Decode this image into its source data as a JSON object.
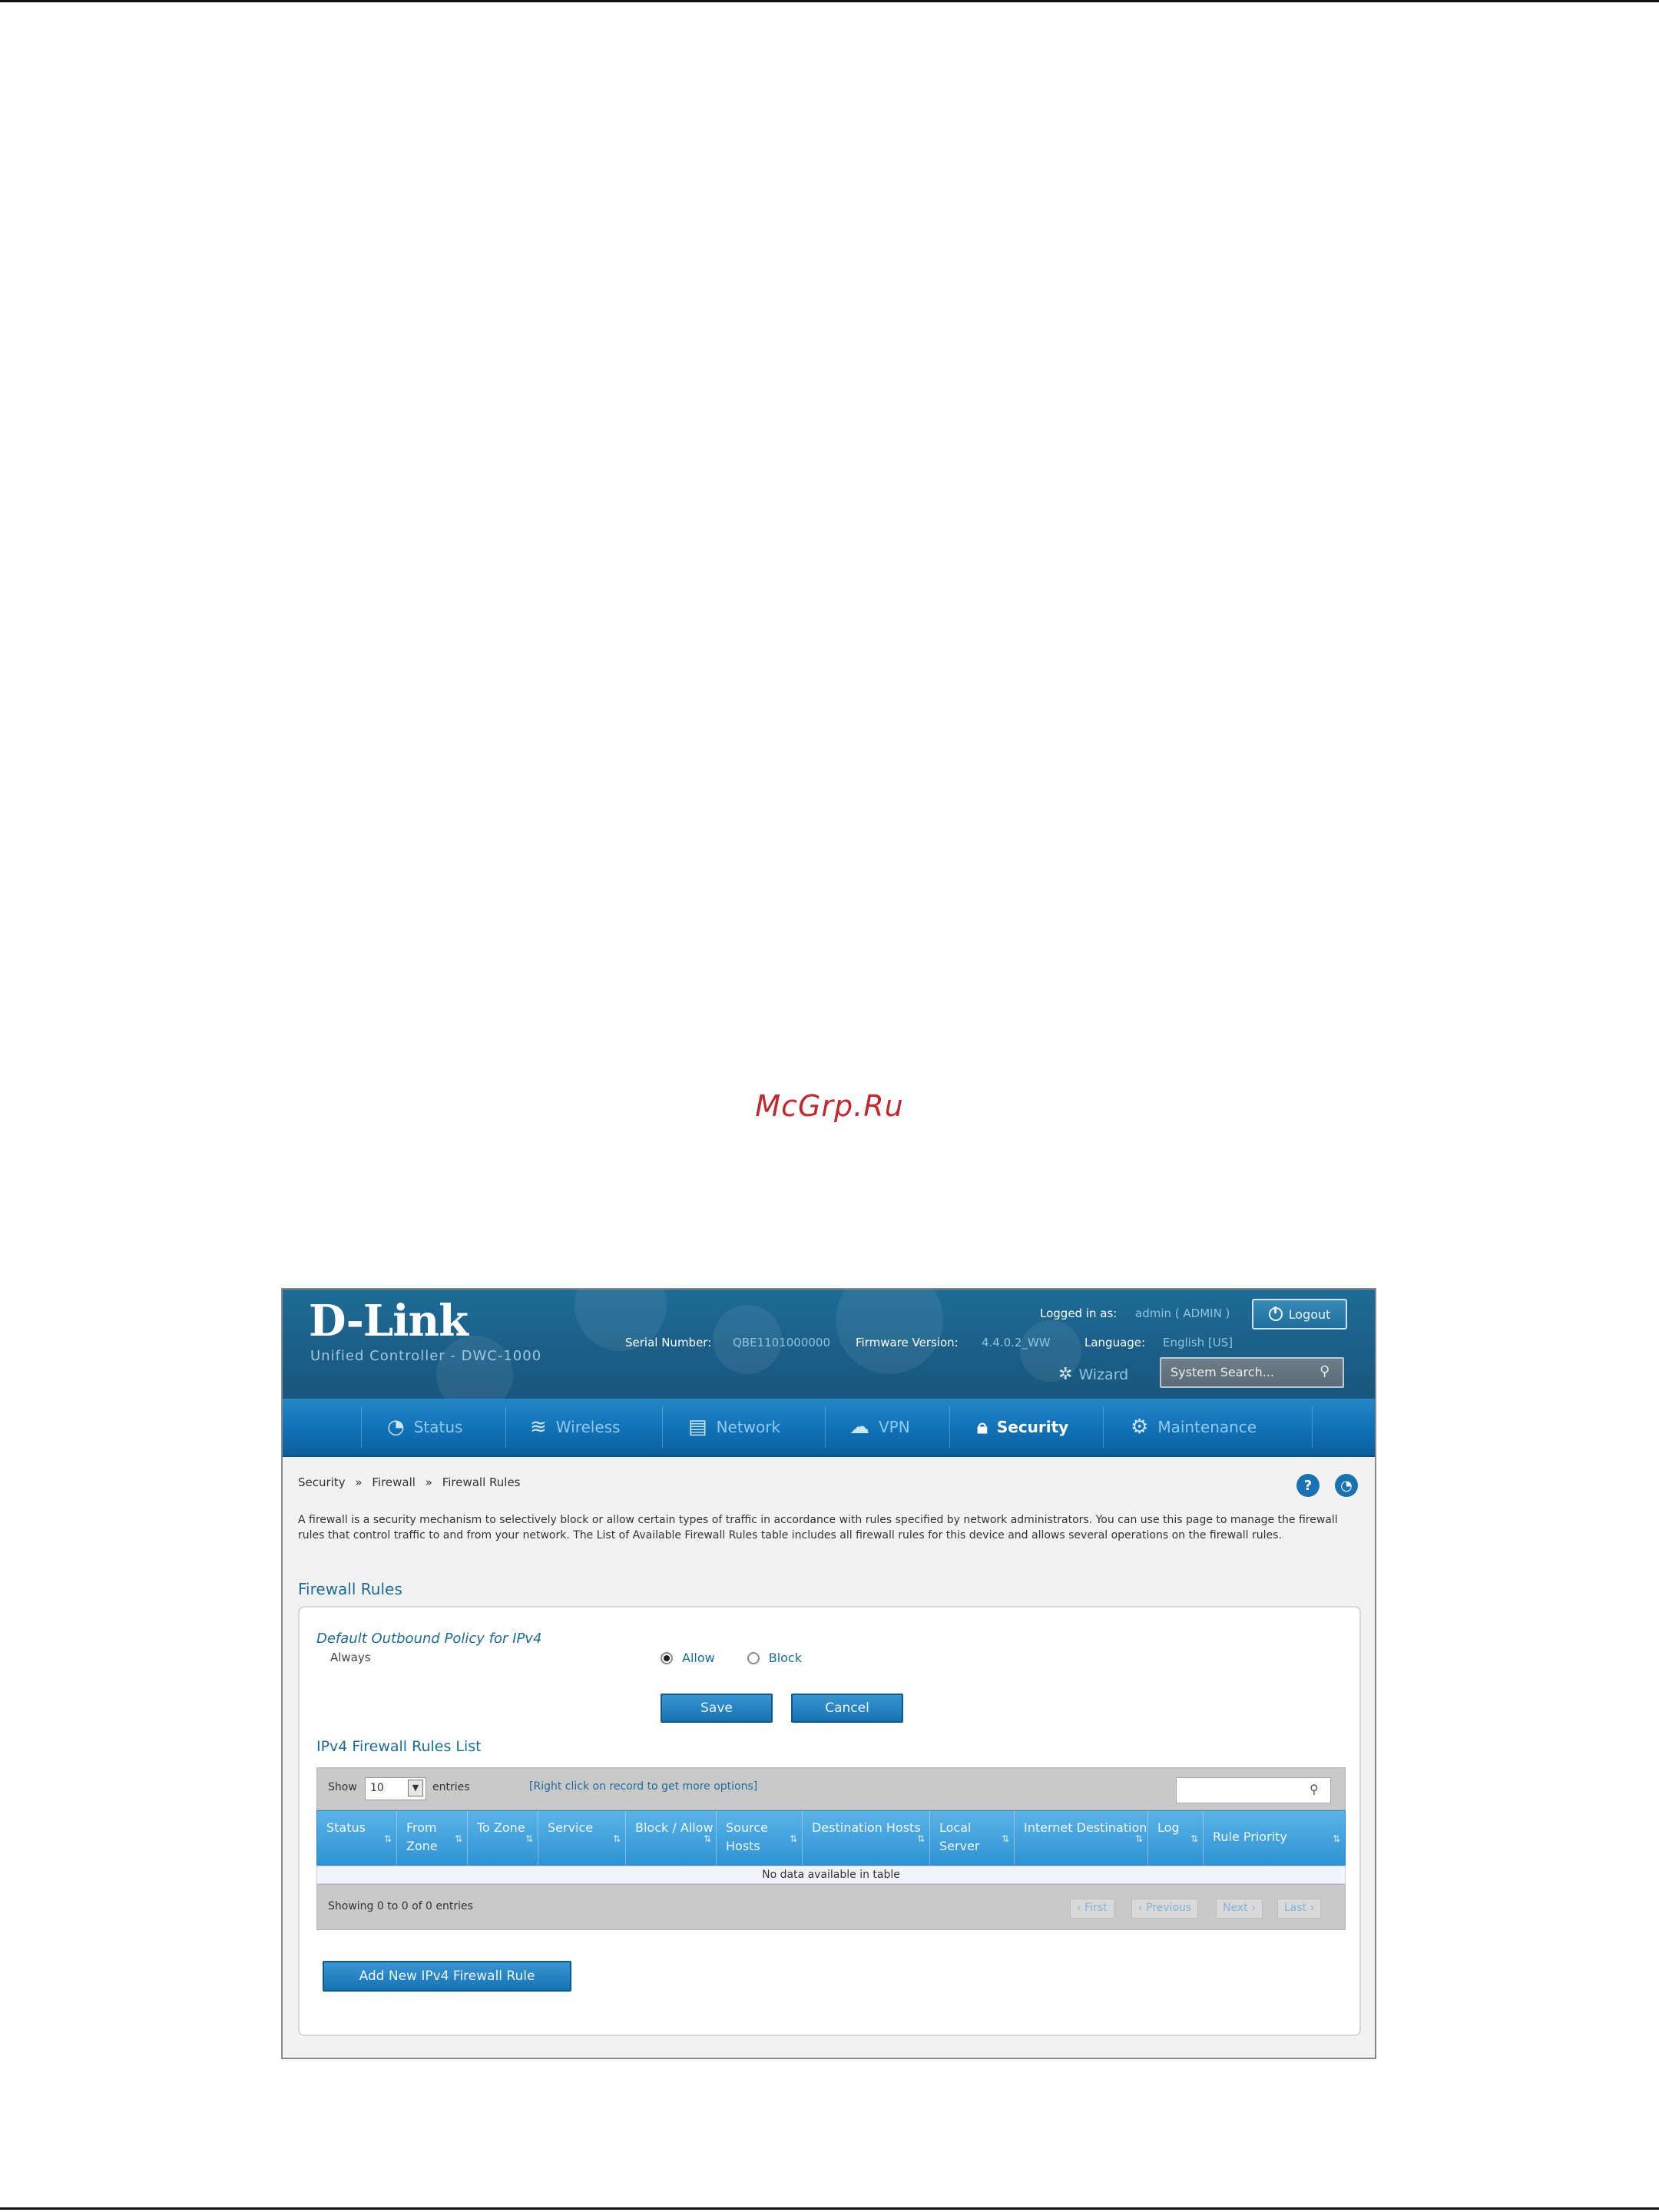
{
  "watermark": "McGrp.Ru",
  "header": {
    "logo": "D-Link",
    "logo_subtitle": "Unified Controller - DWC-1000",
    "logged_in_label": "Logged in as:",
    "logged_in_user": "admin ( ADMIN )",
    "logout_label": "Logout",
    "serial_label": "Serial Number:",
    "serial_value": "QBE1101000000",
    "firmware_label": "Firmware Version:",
    "firmware_value": "4.4.0.2_WW",
    "language_label": "Language:",
    "language_value": "English [US]",
    "wizard_label": "Wizard",
    "search_placeholder": "System Search..."
  },
  "nav": {
    "items": [
      {
        "label": "Status",
        "icon": "gauge-icon"
      },
      {
        "label": "Wireless",
        "icon": "wifi-icon"
      },
      {
        "label": "Network",
        "icon": "network-icon"
      },
      {
        "label": "VPN",
        "icon": "cloud-icon"
      },
      {
        "label": "Security",
        "icon": "lock-icon",
        "active": true
      },
      {
        "label": "Maintenance",
        "icon": "gears-icon"
      }
    ]
  },
  "breadcrumb": {
    "items": [
      "Security",
      "Firewall",
      "Firewall Rules"
    ],
    "separator": "»"
  },
  "description": "A firewall is a security mechanism to selectively block or allow certain types of traffic in accordance with rules specified by network administrators. You can use this page to manage the firewall rules that control traffic to and from your network. The List of Available Firewall Rules table includes all firewall rules for this device and allows several operations on the firewall rules.",
  "section_title": "Firewall Rules",
  "policy": {
    "title": "Default Outbound Policy for IPv4",
    "label": "Always",
    "option_allow": "Allow",
    "option_block": "Block",
    "selected": "Allow",
    "save_label": "Save",
    "cancel_label": "Cancel"
  },
  "list": {
    "title": "IPv4 Firewall Rules List",
    "show_label": "Show",
    "show_value": "10",
    "entries_label": "entries",
    "hint": "[Right click on record to get more options]",
    "columns": [
      "Status",
      "From Zone",
      "To Zone",
      "Service",
      "Block / Allow",
      "Source Hosts",
      "Destination Hosts",
      "Local Server",
      "Internet Destination",
      "Log",
      "Rule Priority"
    ],
    "empty_text": "No data available in table",
    "showing_text": "Showing 0 to 0 of 0 entries",
    "pager": [
      "First",
      "Previous",
      "Next",
      "Last"
    ],
    "add_label": "Add New IPv4 Firewall Rule"
  },
  "colors": {
    "header_blue": "#1d6c97",
    "nav_blue": "#0f6fb3",
    "table_header_blue": "#2e93d4",
    "watermark_red": "#c0292f"
  }
}
